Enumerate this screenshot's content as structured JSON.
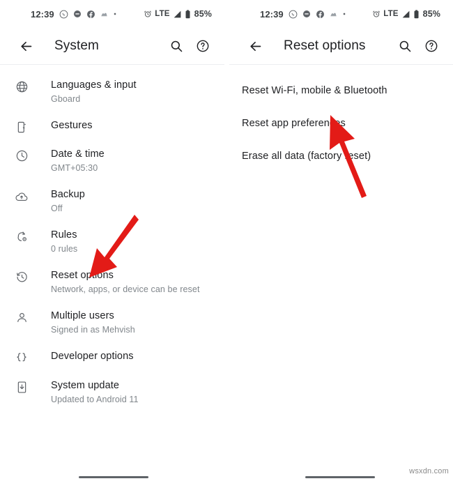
{
  "status_bar": {
    "time": "12:39",
    "app_icons": [
      "whatsapp-icon",
      "messages-icon",
      "facebook-icon",
      "app-icon",
      "dot-icon"
    ],
    "alarm_icon": "alarm-icon",
    "network": "LTE",
    "signal_icon": "signal-bars-icon",
    "battery_icon": "battery-icon",
    "battery": "85%"
  },
  "left_screen": {
    "appbar": {
      "back_icon": "back-arrow-icon",
      "title": "System",
      "search_icon": "search-icon",
      "help_icon": "help-icon"
    },
    "items": [
      {
        "icon": "globe-icon",
        "title": "Languages & input",
        "subtitle": "Gboard"
      },
      {
        "icon": "gestures-icon",
        "title": "Gestures",
        "subtitle": ""
      },
      {
        "icon": "clock-icon",
        "title": "Date & time",
        "subtitle": "GMT+05:30"
      },
      {
        "icon": "cloud-upload-icon",
        "title": "Backup",
        "subtitle": "Off"
      },
      {
        "icon": "rules-icon",
        "title": "Rules",
        "subtitle": "0 rules"
      },
      {
        "icon": "restore-icon",
        "title": "Reset options",
        "subtitle": "Network, apps, or device can be reset"
      },
      {
        "icon": "person-icon",
        "title": "Multiple users",
        "subtitle": "Signed in as Mehvish"
      },
      {
        "icon": "braces-icon",
        "title": "Developer options",
        "subtitle": ""
      },
      {
        "icon": "system-update-icon",
        "title": "System update",
        "subtitle": "Updated to Android 11"
      }
    ]
  },
  "right_screen": {
    "appbar": {
      "back_icon": "back-arrow-icon",
      "title": "Reset options",
      "search_icon": "search-icon",
      "help_icon": "help-icon"
    },
    "items": [
      {
        "title": "Reset Wi-Fi, mobile & Bluetooth"
      },
      {
        "title": "Reset app preferences"
      },
      {
        "title": "Erase all data (factory reset)"
      }
    ]
  },
  "annotations": {
    "arrow_color": "#E31B17",
    "left_arrow_target": "Reset options",
    "right_arrow_target": "Reset app preferences"
  },
  "watermark": "wsxdn.com"
}
